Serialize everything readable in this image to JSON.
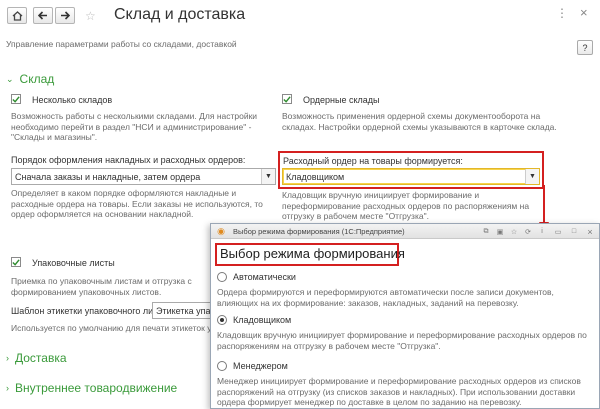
{
  "header": {
    "title": "Склад и доставка",
    "home_icon": "home-icon",
    "back_icon": "arrow-left-icon",
    "forward_icon": "arrow-right-icon",
    "star_icon": "star-icon",
    "more_icon": "dots-icon",
    "close_icon": "close-icon",
    "subtitle": "Управление параметрами работы со складами, доставкой",
    "help_label": "?"
  },
  "sklad": {
    "heading": "Склад",
    "multi_warehouse": {
      "label": "Несколько складов",
      "checked": true,
      "desc": "Возможность работы с несколькими складами. Для настройки необходимо перейти в раздел \"НСИ и администрирование\" - \"Склады и магазины\"."
    },
    "order_warehouses": {
      "label": "Ордерные склады",
      "checked": true,
      "desc": "Возможность применения ордерной схемы документооборота на складах. Настройки ордерной схемы указываются в карточке склада."
    },
    "order_procedure": {
      "label": "Порядок оформления накладных и расходных ордеров:",
      "value": "Сначала заказы и накладные, затем ордера",
      "desc": "Определяет в каком порядке оформляются накладные и расходные ордера на товары. Если заказы не используются, то ордер оформляется на основании накладной."
    },
    "expense_order": {
      "label": "Расходный ордер на товары формируется:",
      "value": "Кладовщиком",
      "desc": "Кладовщик вручную инициирует формирование и переформирование расходных ордеров по распоряжениям на отгрузку в рабочем месте \"Отгрузка\"."
    },
    "packing_lists": {
      "label": "Упаковочные листы",
      "checked": true,
      "desc": "Приемка по упаковочным листам и отгрузка с формированием упаковочных листов."
    },
    "label_template": {
      "label": "Шаблон этикетки упаковочного листа:",
      "value": "Этикетка упакo",
      "desc": "Используется по умолчанию для печати этикеток упаковочных"
    }
  },
  "sections": {
    "delivery": "Доставка",
    "internal": "Внутреннее товародвижение"
  },
  "dialog": {
    "window_title": "Выбор режима формирования  (1С:Предприятие)",
    "heading": "Выбор режима формирования",
    "options": [
      {
        "label": "Автоматически",
        "selected": false,
        "desc": "Ордера формируются и переформируются автоматически после записи документов, влияющих на их формирование: заказов, накладных, заданий на перевозку."
      },
      {
        "label": "Кладовщиком",
        "selected": true,
        "desc": "Кладовщик вручную инициирует формирование и переформирование расходных ордеров по распоряжениям на отгрузку в рабочем месте \"Отгрузка\"."
      },
      {
        "label": "Менеджером",
        "selected": false,
        "desc": "Менеджер инициирует формирование и переформирование расходных ордеров из списков распоряжений на отгрузку (из списков заказов и накладных). При использовании доставки ордера формирует менеджер по доставке в целом по заданию на перевозку."
      }
    ]
  },
  "colors": {
    "accent_green": "#3a9a3a",
    "highlight_red": "#d42020",
    "field_highlight": "#f7d44a"
  }
}
